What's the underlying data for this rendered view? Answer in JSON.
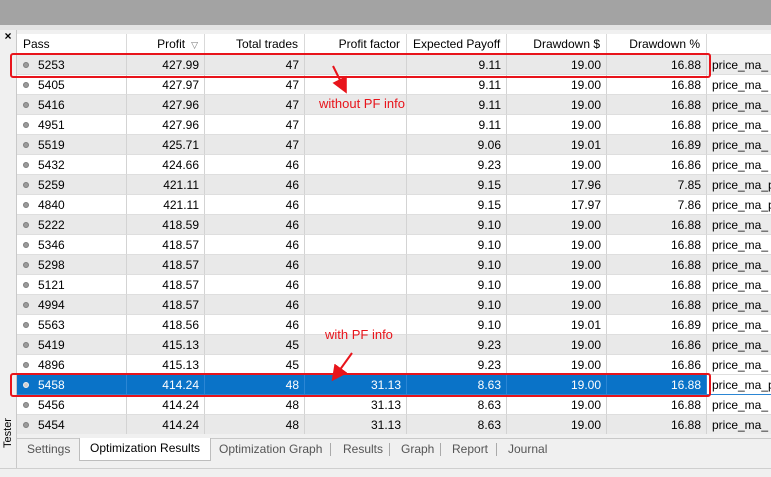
{
  "sidebar": {
    "close_glyph": "×",
    "tester_label": "Tester"
  },
  "columns": [
    "Pass",
    "Profit",
    "Total trades",
    "Profit factor",
    "Expected Payoff",
    "Drawdown $",
    "Drawdown %",
    ""
  ],
  "sort_indicator": "▽",
  "rows": [
    {
      "pass": "5253",
      "profit": "427.99",
      "trades": "47",
      "pf": "",
      "payoff": "9.11",
      "dd": "19.00",
      "ddp": "16.88",
      "params": "price_ma_"
    },
    {
      "pass": "5405",
      "profit": "427.97",
      "trades": "47",
      "pf": "",
      "payoff": "9.11",
      "dd": "19.00",
      "ddp": "16.88",
      "params": "price_ma_"
    },
    {
      "pass": "5416",
      "profit": "427.96",
      "trades": "47",
      "pf": "",
      "payoff": "9.11",
      "dd": "19.00",
      "ddp": "16.88",
      "params": "price_ma_"
    },
    {
      "pass": "4951",
      "profit": "427.96",
      "trades": "47",
      "pf": "",
      "payoff": "9.11",
      "dd": "19.00",
      "ddp": "16.88",
      "params": "price_ma_"
    },
    {
      "pass": "5519",
      "profit": "425.71",
      "trades": "47",
      "pf": "",
      "payoff": "9.06",
      "dd": "19.01",
      "ddp": "16.89",
      "params": "price_ma_"
    },
    {
      "pass": "5432",
      "profit": "424.66",
      "trades": "46",
      "pf": "",
      "payoff": "9.23",
      "dd": "19.00",
      "ddp": "16.86",
      "params": "price_ma_"
    },
    {
      "pass": "5259",
      "profit": "421.11",
      "trades": "46",
      "pf": "",
      "payoff": "9.15",
      "dd": "17.96",
      "ddp": "7.85",
      "params": "price_ma_p"
    },
    {
      "pass": "4840",
      "profit": "421.11",
      "trades": "46",
      "pf": "",
      "payoff": "9.15",
      "dd": "17.97",
      "ddp": "7.86",
      "params": "price_ma_p"
    },
    {
      "pass": "5222",
      "profit": "418.59",
      "trades": "46",
      "pf": "",
      "payoff": "9.10",
      "dd": "19.00",
      "ddp": "16.88",
      "params": "price_ma_"
    },
    {
      "pass": "5346",
      "profit": "418.57",
      "trades": "46",
      "pf": "",
      "payoff": "9.10",
      "dd": "19.00",
      "ddp": "16.88",
      "params": "price_ma_"
    },
    {
      "pass": "5298",
      "profit": "418.57",
      "trades": "46",
      "pf": "",
      "payoff": "9.10",
      "dd": "19.00",
      "ddp": "16.88",
      "params": "price_ma_"
    },
    {
      "pass": "5121",
      "profit": "418.57",
      "trades": "46",
      "pf": "",
      "payoff": "9.10",
      "dd": "19.00",
      "ddp": "16.88",
      "params": "price_ma_"
    },
    {
      "pass": "4994",
      "profit": "418.57",
      "trades": "46",
      "pf": "",
      "payoff": "9.10",
      "dd": "19.00",
      "ddp": "16.88",
      "params": "price_ma_"
    },
    {
      "pass": "5563",
      "profit": "418.56",
      "trades": "46",
      "pf": "",
      "payoff": "9.10",
      "dd": "19.01",
      "ddp": "16.89",
      "params": "price_ma_"
    },
    {
      "pass": "5419",
      "profit": "415.13",
      "trades": "45",
      "pf": "",
      "payoff": "9.23",
      "dd": "19.00",
      "ddp": "16.86",
      "params": "price_ma_"
    },
    {
      "pass": "4896",
      "profit": "415.13",
      "trades": "45",
      "pf": "",
      "payoff": "9.23",
      "dd": "19.00",
      "ddp": "16.86",
      "params": "price_ma_"
    },
    {
      "pass": "5458",
      "profit": "414.24",
      "trades": "48",
      "pf": "31.13",
      "payoff": "8.63",
      "dd": "19.00",
      "ddp": "16.88",
      "params": "price_ma_p",
      "selected": true
    },
    {
      "pass": "5456",
      "profit": "414.24",
      "trades": "48",
      "pf": "31.13",
      "payoff": "8.63",
      "dd": "19.00",
      "ddp": "16.88",
      "params": "price_ma_"
    },
    {
      "pass": "5454",
      "profit": "414.24",
      "trades": "48",
      "pf": "31.13",
      "payoff": "8.63",
      "dd": "19.00",
      "ddp": "16.88",
      "params": "price_ma_"
    }
  ],
  "annotations": {
    "without": "without PF info",
    "with": "with PF info",
    "color": "#e8141b"
  },
  "tabs": [
    "Settings",
    "Optimization Results",
    "Optimization Graph",
    "Results",
    "Graph",
    "Report",
    "Journal"
  ],
  "active_tab": "Optimization Results",
  "colors": {
    "selection": "#0a73c8",
    "stripe": "#e9e9e9",
    "header_bg": "#ffffff"
  }
}
